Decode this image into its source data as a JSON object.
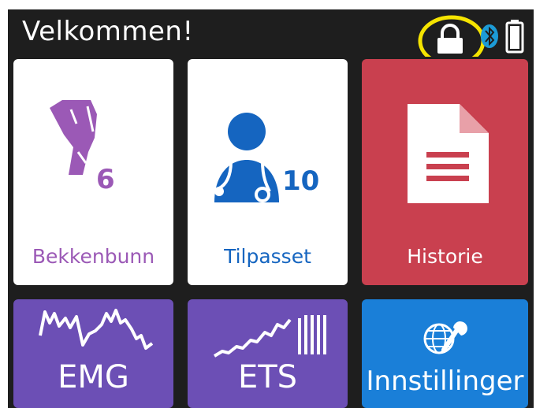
{
  "header": {
    "title": "Velkommen!",
    "icons": [
      "lock-icon",
      "bluetooth-icon",
      "battery-icon"
    ],
    "highlight_color": "#f5e400"
  },
  "tiles": {
    "pelvic": {
      "label": "Bekkenbunn",
      "count": "6",
      "color": "#9b59b6",
      "icon": "pelvis-icon"
    },
    "custom": {
      "label": "Tilpasset",
      "count": "10",
      "color": "#1565c0",
      "icon": "doctor-icon"
    },
    "history": {
      "label": "Historie",
      "color": "#c9404f",
      "icon": "document-icon"
    },
    "emg": {
      "label": "EMG",
      "color": "#6c4fb5",
      "icon": "emg-wave-icon"
    },
    "ets": {
      "label": "ETS",
      "color": "#6c4fb5",
      "icon": "ets-wave-icon"
    },
    "settings": {
      "label": "Innstillinger",
      "color": "#1a7fd8",
      "icon": "globe-wrench-icon"
    }
  }
}
